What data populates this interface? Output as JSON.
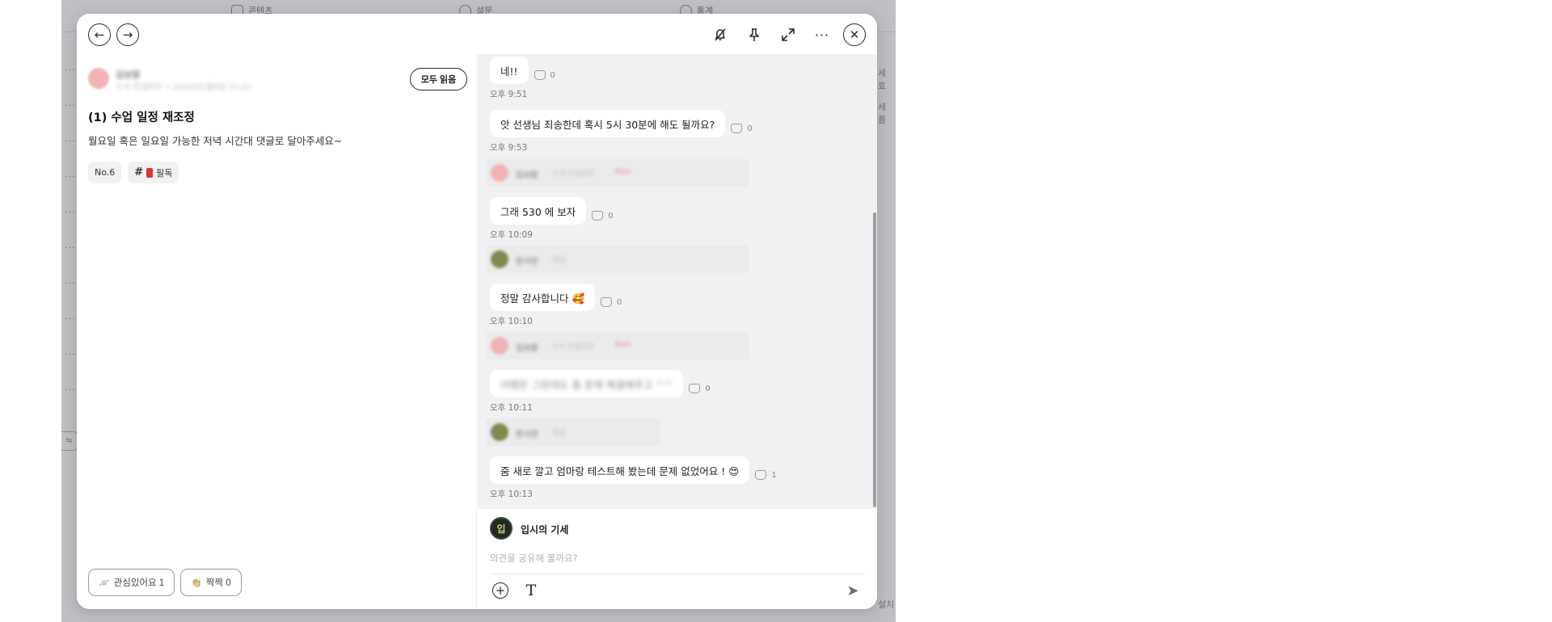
{
  "background": {
    "nav": [
      {
        "label": "콘텐츠",
        "icon": "content-icon"
      },
      {
        "label": "설문",
        "icon": "survey-icon"
      },
      {
        "label": "통계",
        "icon": "stats-icon"
      }
    ],
    "right_fragments": [
      "세 효",
      "세 폴",
      "설치"
    ],
    "side_toggle_label": "⇆"
  },
  "header": {
    "back_icon": "arrow-left-icon",
    "forward_icon": "arrow-right-icon",
    "actions": [
      "notification-off-icon",
      "pin-icon",
      "expand-icon",
      "more-icon",
      "close-icon"
    ]
  },
  "post": {
    "author_name": "김보람",
    "author_meta": "수석 컨설턴트 • 2024년2월9일 21:22",
    "read_all_label": "모두 읽음",
    "title": "(1) 수업 일정 재조정",
    "body": "월요일 혹은 일요일 가능한 저녁 시간대 댓글로 달아주세요~",
    "tags": [
      {
        "label": "No.6",
        "hash": false
      },
      {
        "label": "필독",
        "hash": true
      }
    ],
    "reactions": [
      {
        "label": "관심있어요 1",
        "emoji": "🪐"
      },
      {
        "label": "짝짝 0",
        "emoji": "👏"
      }
    ]
  },
  "comments": {
    "items": [
      {
        "text": "네!!",
        "likes": "0",
        "time": "오후 9:51"
      },
      {
        "text": "앗 선생님 죄송한데 혹시 5시 30분에 해도 될까요?",
        "likes": "0",
        "time": "오후 9:53"
      },
      {
        "sender": "김보람",
        "sender_meta": "수석 컨설턴트",
        "sender_tag": "Kom",
        "text": "그래 530 에 보자",
        "likes": "0",
        "time": "오후 10:09"
      },
      {
        "sender": "한서연",
        "sender_meta": "학생",
        "text": "정말 감사합니다 🥰",
        "likes": "0",
        "time": "오후 10:10"
      },
      {
        "sender": "김보람",
        "sender_meta": "수석 컨설턴트",
        "sender_tag": "Kom",
        "text": "어쨌든 그런데도 좀 문제 해결해주고 ^^",
        "likes": "0",
        "time": "오후 10:11"
      },
      {
        "sender": "한서연",
        "sender_meta": "학생",
        "text": "줌 새로 깔고 엄마랑 테스트해 봤는데 문제 없었어요 ! 😍",
        "likes": "1",
        "time": "오후 10:13"
      }
    ]
  },
  "composer": {
    "avatar_text": "입",
    "name": "입시의 기세",
    "placeholder": "의견을 공유해 볼까요?",
    "value": ""
  }
}
